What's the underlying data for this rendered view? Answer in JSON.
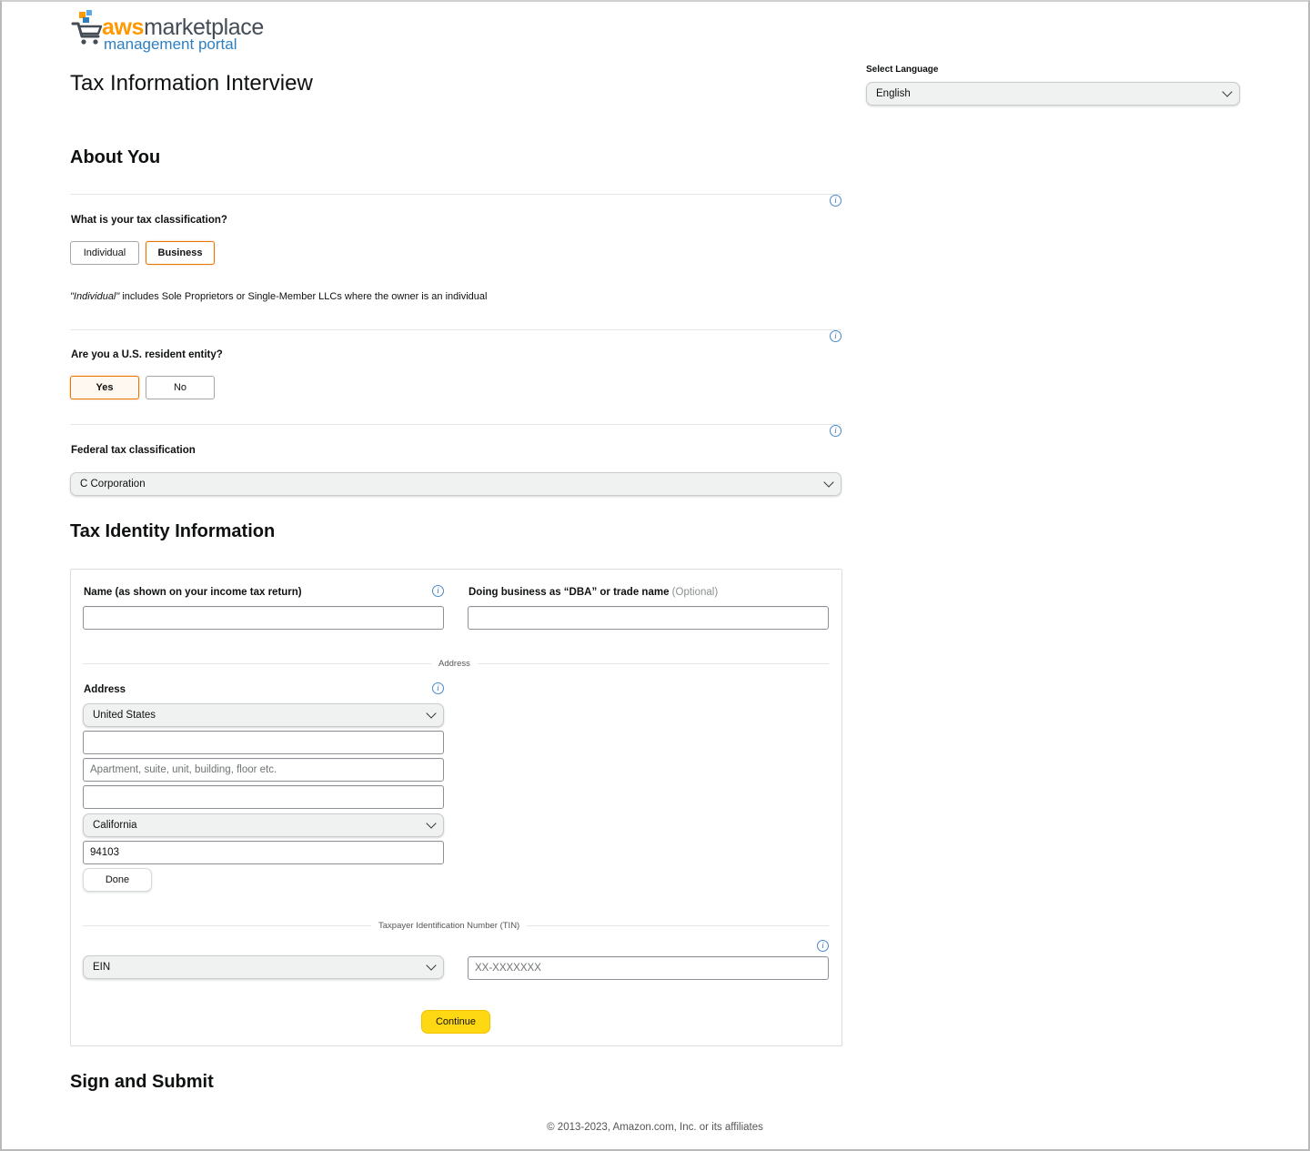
{
  "logo": {
    "brand_aws": "aws",
    "brand_marketplace": "marketplace",
    "subtitle": "management portal"
  },
  "header": {
    "title": "Tax Information Interview",
    "language_label": "Select Language",
    "language_value": "English"
  },
  "about": {
    "title": "About You",
    "classification_question": "What is your tax classification?",
    "classification_options": [
      "Individual",
      "Business"
    ],
    "classification_selected": "Business",
    "classification_note_italic": "\"Individual\"",
    "classification_note_rest": " includes Sole Proprietors or Single-Member LLCs where the owner is an individual",
    "resident_question": "Are you a U.S. resident entity?",
    "resident_options": [
      "Yes",
      "No"
    ],
    "resident_selected": "Yes",
    "federal_label": "Federal tax classification",
    "federal_value": "C Corporation"
  },
  "tax_identity": {
    "title": "Tax Identity Information",
    "name_label": "Name (as shown on your income tax return)",
    "name_value": "",
    "dba_label": "Doing business as “DBA” or trade name",
    "dba_optional": "(Optional)",
    "dba_value": "",
    "address_divider": "Address",
    "address_label": "Address",
    "country_value": "United States",
    "street_value": "",
    "apt_placeholder": "Apartment, suite, unit, building, floor etc.",
    "city_value": "",
    "state_value": "California",
    "zip_value": "94103",
    "done_label": "Done",
    "tin_divider": "Taxpayer Identification Number (TIN)",
    "tin_type_value": "EIN",
    "tin_placeholder": "XX-XXXXXXX",
    "continue_label": "Continue"
  },
  "sign": {
    "title": "Sign and Submit"
  },
  "footer": {
    "copyright": "© 2013-2023, Amazon.com, Inc. or its affiliates"
  },
  "colors": {
    "accent_orange": "#ff9900",
    "selected_border": "#e77600",
    "continue_yellow": "#ffd814",
    "link_blue": "#2d7fc2"
  }
}
